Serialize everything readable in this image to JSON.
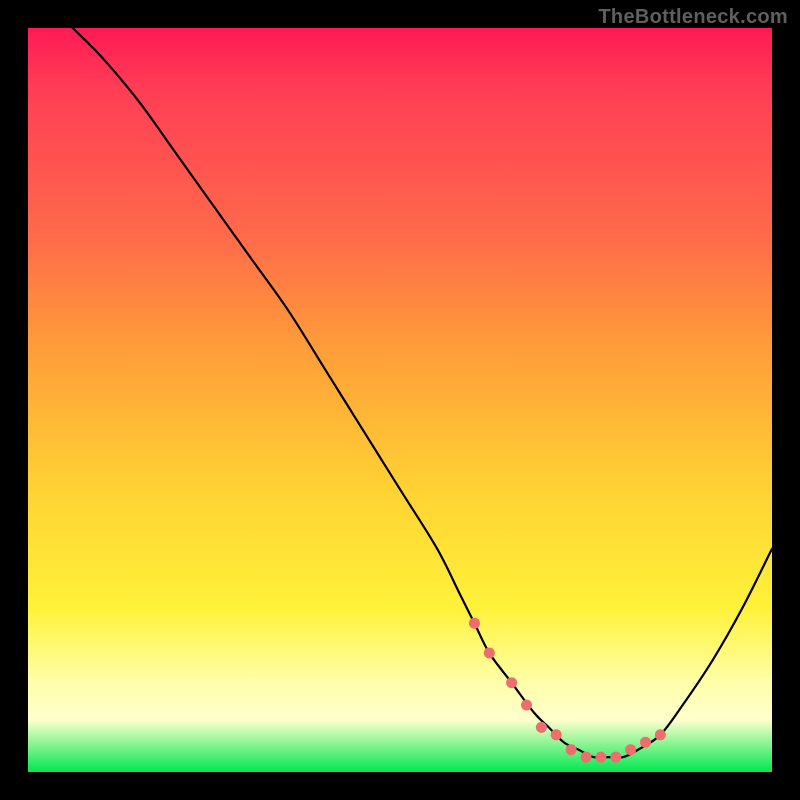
{
  "watermark": "TheBottleneck.com",
  "chart_data": {
    "type": "line",
    "title": "",
    "xlabel": "",
    "ylabel": "",
    "xlim": [
      0,
      100
    ],
    "ylim": [
      0,
      100
    ],
    "grid": false,
    "legend": false,
    "series": [
      {
        "name": "curve",
        "color": "#000000",
        "x": [
          6,
          10,
          15,
          20,
          25,
          30,
          35,
          40,
          45,
          50,
          55,
          58,
          60,
          62,
          65,
          68,
          70,
          72,
          74,
          76,
          78,
          80,
          82,
          85,
          88,
          92,
          96,
          100
        ],
        "y": [
          100,
          96,
          90,
          83,
          76,
          69,
          62,
          54,
          46,
          38,
          30,
          24,
          20,
          16,
          12,
          8,
          6,
          4,
          3,
          2,
          2,
          2,
          3,
          5,
          9,
          15,
          22,
          30
        ]
      }
    ],
    "highlight_points": {
      "name": "dots",
      "color": "#ee6e6e",
      "x": [
        60,
        62,
        65,
        67,
        69,
        71,
        73,
        75,
        77,
        79,
        81,
        83,
        85
      ],
      "y": [
        20,
        16,
        12,
        9,
        6,
        5,
        3,
        2,
        2,
        2,
        3,
        4,
        5
      ]
    }
  }
}
